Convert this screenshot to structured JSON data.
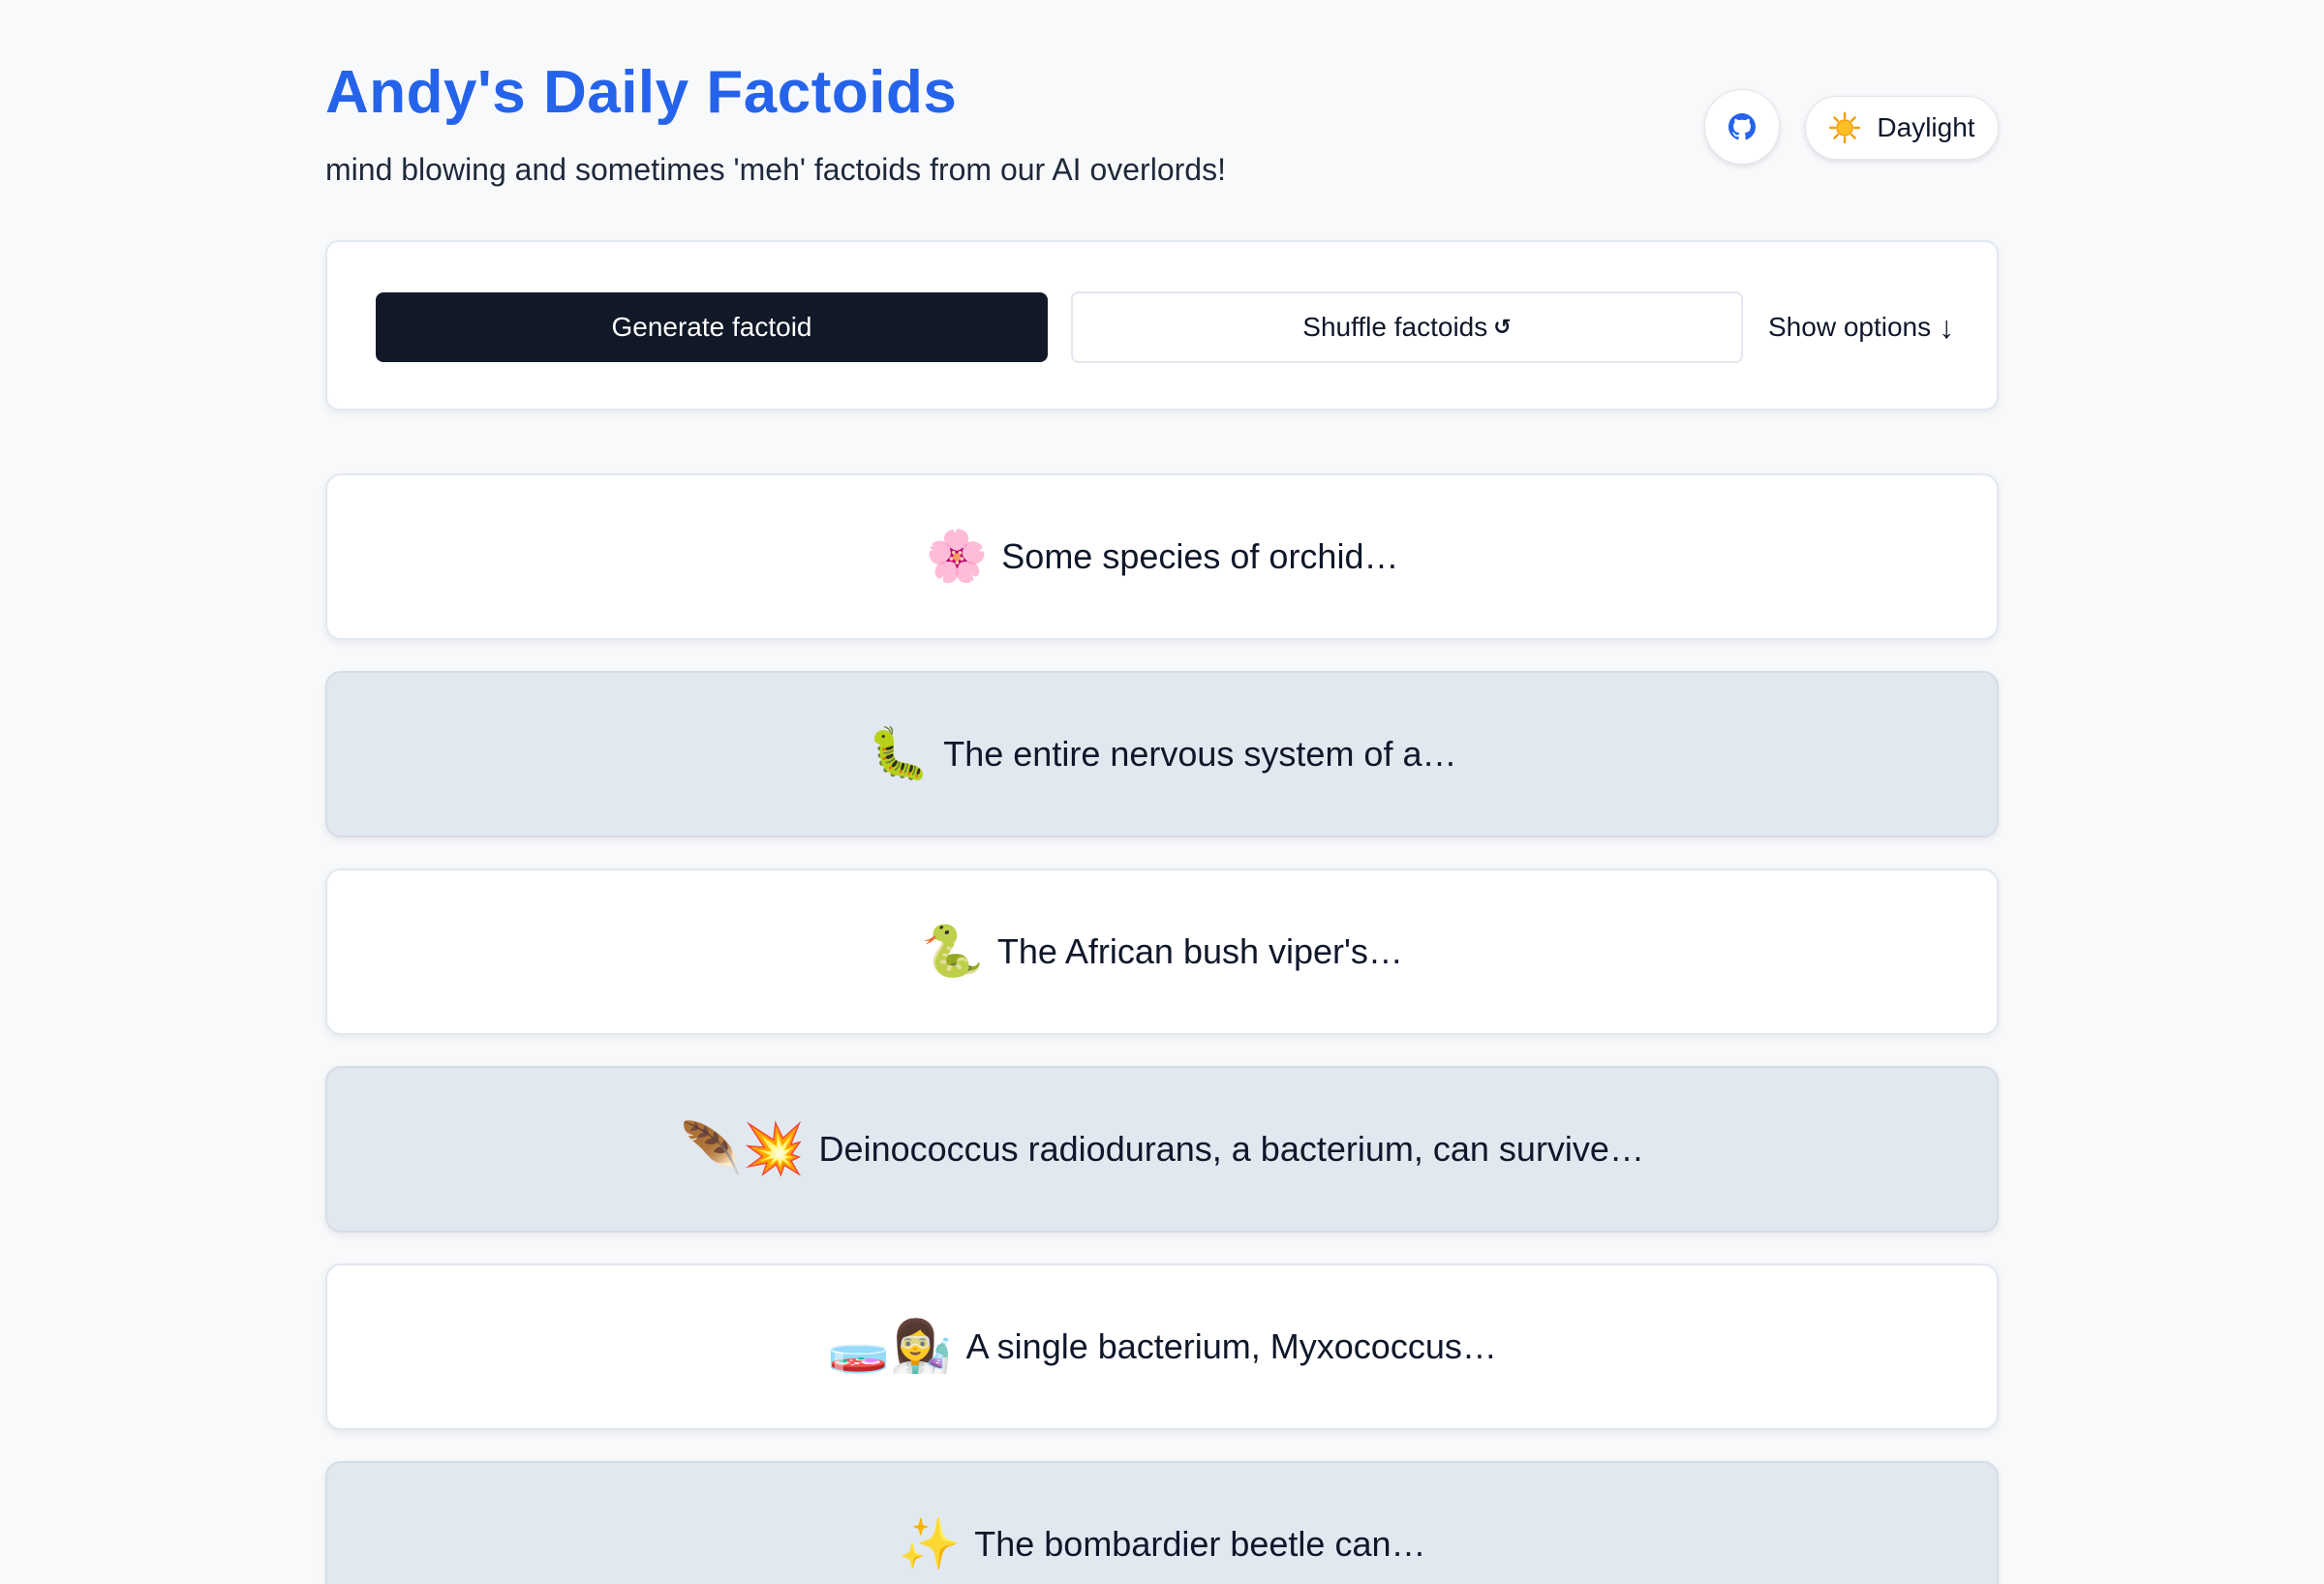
{
  "header": {
    "title": "Andy's Daily Factoids",
    "subtitle": "mind blowing and sometimes 'meh' factoids from our AI overlords!",
    "github_icon": "github-icon",
    "theme": {
      "icon": "sun-icon",
      "label": "Daylight"
    }
  },
  "controls": {
    "generate_label": "Generate factoid",
    "shuffle_label": "Shuffle factoids",
    "shuffle_icon": "↺",
    "options_label": "Show options",
    "options_arrow": "↓"
  },
  "factoids": [
    {
      "emoji": "🌸",
      "text": "Some species of orchid…"
    },
    {
      "emoji": "🐛",
      "text": "The entire nervous system of a…"
    },
    {
      "emoji": "🐍",
      "text": "The African bush viper's…"
    },
    {
      "emoji": "🪶💥",
      "text": "Deinococcus radiodurans, a bacterium, can survive…"
    },
    {
      "emoji": "🧫👩‍🔬",
      "text": "A single bacterium, Myxococcus…"
    },
    {
      "emoji": "✨",
      "text": "The bombardier beetle can…"
    }
  ],
  "colors": {
    "accent": "#2563eb",
    "primary_button": "#111827",
    "card_alt": "#e2e8f0"
  }
}
